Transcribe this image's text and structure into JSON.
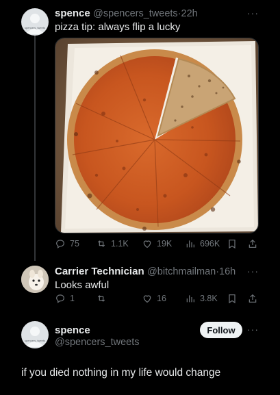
{
  "tweet": {
    "display_name": "spence",
    "handle": "@spencers_tweets",
    "separator": "·",
    "time": "22h",
    "text": "pizza tip: always flip a lucky",
    "avatar_text": "spencers_tweets",
    "more": "···",
    "stats": {
      "replies": "75",
      "retweets": "1.1K",
      "likes": "19K",
      "views": "696K"
    }
  },
  "reply": {
    "display_name": "Carrier Technician",
    "handle": "@bitchmailman",
    "separator": "·",
    "time": "16h",
    "text": "Looks awful",
    "more": "···",
    "stats": {
      "replies": "1",
      "retweets": "",
      "likes": "16",
      "views": "3.8K"
    }
  },
  "profile": {
    "display_name": "spence",
    "handle": "@spencers_tweets",
    "avatar_text": "spencers_tweets",
    "follow_label": "Follow",
    "more": "···",
    "quote": "if you died nothing in my life would change"
  },
  "icons": [
    "reply-icon",
    "retweet-icon",
    "like-icon",
    "views-icon",
    "bookmark-icon",
    "share-icon",
    "more-icon"
  ],
  "colors": {
    "background": "#000000",
    "text": "#e7e9ea",
    "muted": "#71767b",
    "button_bg": "#eff3f4"
  }
}
